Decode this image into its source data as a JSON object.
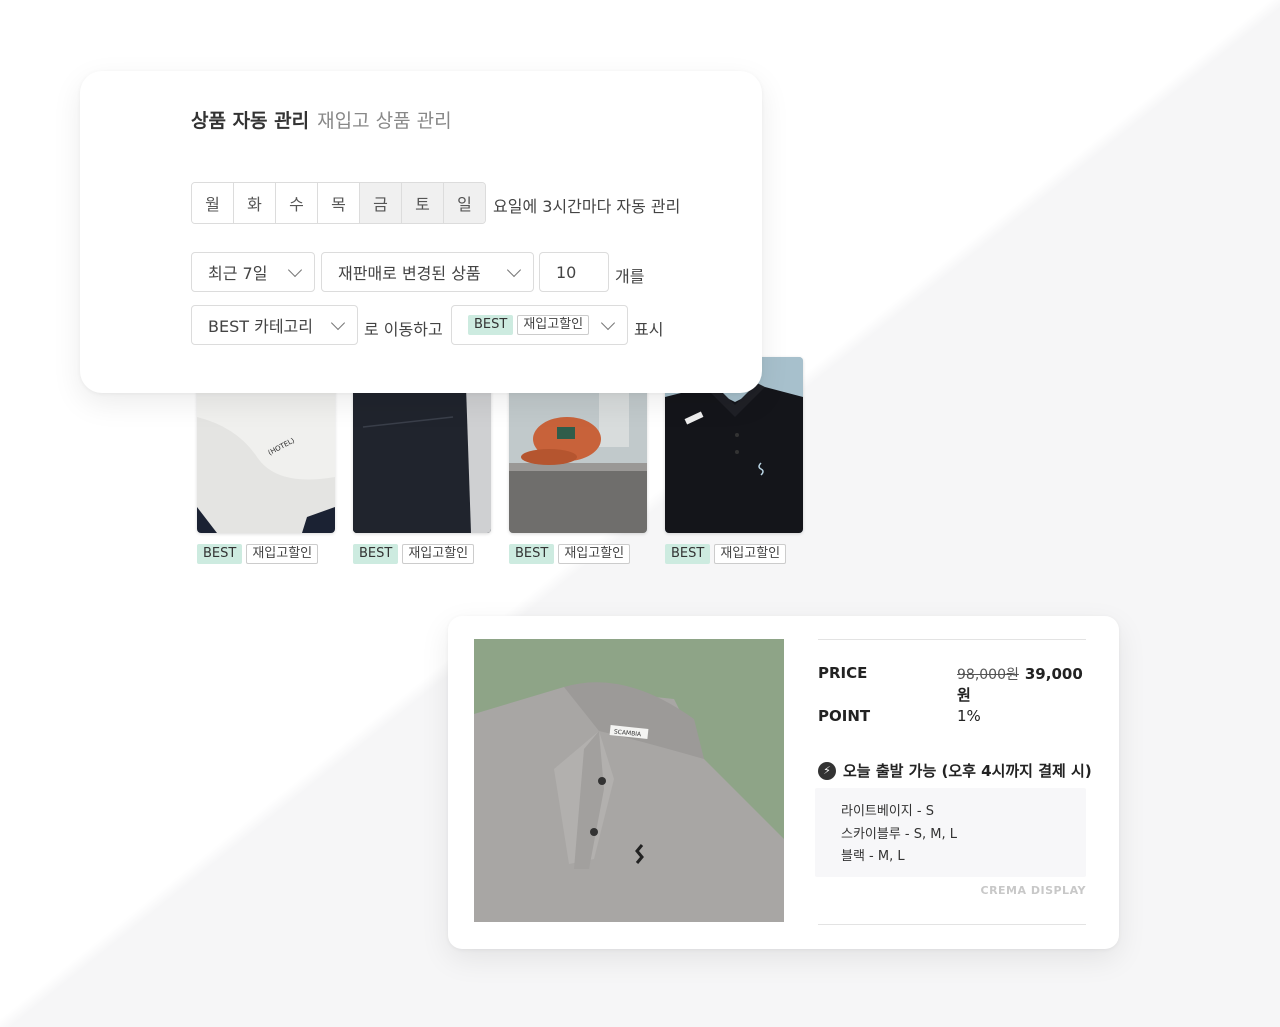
{
  "settings": {
    "title": "상품 자동 관리",
    "subtitle": "재입고 상품 관리",
    "days": [
      "월",
      "화",
      "수",
      "목",
      "금",
      "토",
      "일"
    ],
    "active_days": [
      4,
      5,
      6
    ],
    "schedule_text": "요일에 3시간마다 자동 관리",
    "period_select": "최근 7일",
    "condition_select": "재판매로 변경된 상품",
    "count_value": "10",
    "count_suffix": "개를",
    "category_select": "BEST 카테고리",
    "move_text": "로 이동하고",
    "badge_best": "BEST",
    "badge_restock": "재입고할인",
    "display_text": "표시"
  },
  "thumbnails": [
    {
      "name": "white-tshirt",
      "tag_best": "BEST",
      "tag_restock": "재입고할인",
      "print": "(HOTEL)"
    },
    {
      "name": "black-jeans",
      "tag_best": "BEST",
      "tag_restock": "재입고할인"
    },
    {
      "name": "orange-cap",
      "tag_best": "BEST",
      "tag_restock": "재입고할인"
    },
    {
      "name": "black-polo",
      "tag_best": "BEST",
      "tag_restock": "재입고할인"
    }
  ],
  "product": {
    "brand_label": "SCAMBIA",
    "price_label": "PRICE",
    "original_price": "98,000원",
    "sale_price": "39,000원",
    "point_label": "POINT",
    "point_value": "1%",
    "shipping_text": "오늘 출발 가능 (오후 4시까지 결제 시)",
    "stock": [
      "라이트베이지 - S",
      "스카이블루 - S, M, L",
      "블랙 - M, L"
    ],
    "watermark": "CREMA DISPLAY",
    "image_bg": "#8ea487"
  }
}
